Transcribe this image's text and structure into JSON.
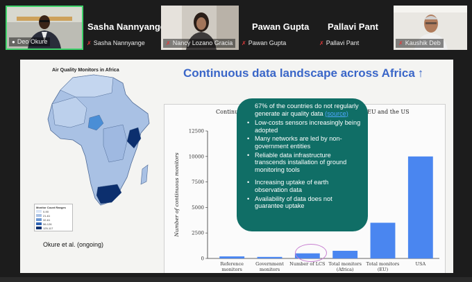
{
  "participants": {
    "deo": {
      "name": "Deo Okure"
    },
    "sasha": {
      "name": "Sasha Nannyange",
      "tile_name": "Sasha Nannyange"
    },
    "nancy": {
      "name": "Nancy Lozano Gracia"
    },
    "pawan": {
      "name": "Pawan Gupta",
      "tile_name": "Pawan Gupta"
    },
    "pallavi": {
      "name": "Pallavi Pant",
      "tile_name": "Pallavi Pant"
    },
    "kaushik": {
      "name": "Kaushik Deb"
    }
  },
  "slide": {
    "title": "Continuous data landscape across Africa",
    "title_arrow": "↑",
    "map_title": "Air Quality Monitors in Africa",
    "map_legend_title": "Monitor Count Ranges",
    "map_legend": [
      "0-90",
      "21-61",
      "32-61",
      "56-126",
      "125-117"
    ],
    "citation": "Okure et al. (ongoing)",
    "chart_title_left": "Continuo",
    "chart_title_right": "EU and the US",
    "callout": {
      "intro": "67% of the countries do not regularly generate air quality data",
      "intro_link": "(source)",
      "bullets": [
        "Low-costs sensors increasingly being adopted",
        "Many networks are led by non-government entities",
        "Reliable data infrastructure transcends installation of ground monitoring tools",
        "Increasing uptake of earth observation data",
        "Availability of data does not guarantee uptake"
      ]
    }
  },
  "colors": {
    "bar": "#4a86f0",
    "callout": "#106e66",
    "title": "#3a66c8",
    "active_speaker_border": "#3fd36b"
  },
  "icons": {
    "mic_muted": "mic-muted-icon",
    "mic_on": "mic-icon"
  },
  "chart_data": {
    "type": "bar",
    "ylabel": "Number of continuous monitors",
    "ylim": [
      0,
      12500
    ],
    "yticks": [
      0,
      2500,
      5000,
      7500,
      10000,
      12500
    ],
    "categories": [
      "Reference monitors",
      "Government monitors",
      "Number of LCS",
      "Total monitors (Africa)",
      "Total monitors (EU)",
      "USA"
    ],
    "category_lines": [
      [
        "Reference",
        "monitors"
      ],
      [
        "Government",
        "monitors"
      ],
      [
        "Number of LCS",
        ""
      ],
      [
        "Total monitors",
        "(Africa)"
      ],
      [
        "Total monitors",
        "(EU)"
      ],
      [
        "USA",
        ""
      ]
    ],
    "values": [
      200,
      150,
      500,
      750,
      3500,
      10000
    ]
  }
}
